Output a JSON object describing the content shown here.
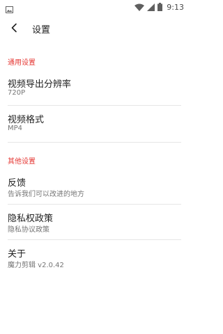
{
  "status_bar": {
    "time": "9:13",
    "icons": [
      "image-notification-icon",
      "wifi-icon",
      "cellular-signal-icon",
      "battery-icon"
    ]
  },
  "app_bar": {
    "back_icon": "back-arrow-icon",
    "title": "设置"
  },
  "sections": [
    {
      "header": "通用设置",
      "items": [
        {
          "title": "视频导出分辨率",
          "summary": "720P"
        },
        {
          "title": "视频格式",
          "summary": "MP4"
        }
      ]
    },
    {
      "header": "其他设置",
      "items": [
        {
          "title": "反馈",
          "summary": "告诉我们可以改进的地方"
        },
        {
          "title": "隐私权政策",
          "summary": "隐私协议政策"
        },
        {
          "title": "关于",
          "summary": "魔力剪辑 v2.0.42"
        }
      ]
    }
  ],
  "colors": {
    "accent": "#e53935",
    "title_text": "#212121",
    "summary_text": "#757575",
    "divider": "#e6e6e6",
    "background": "#ffffff"
  }
}
